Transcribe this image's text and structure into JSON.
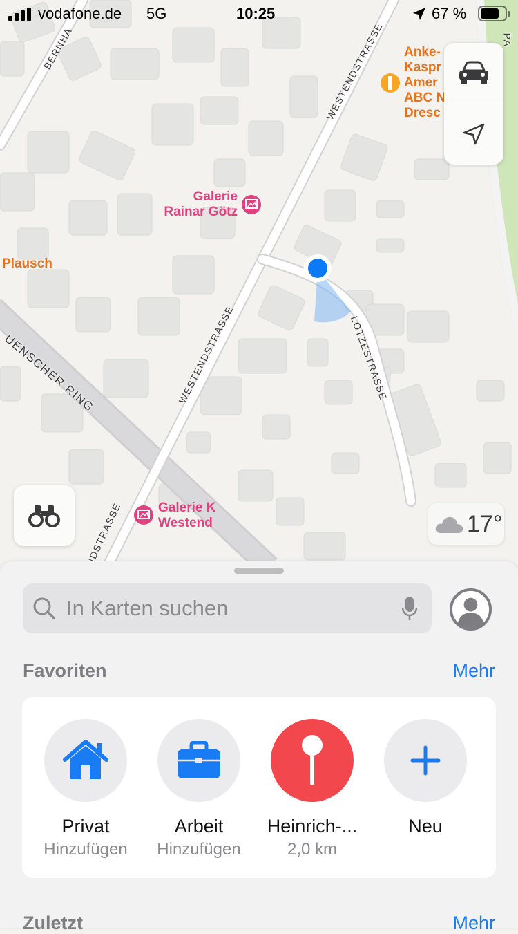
{
  "status_bar": {
    "carrier": "vodafone.de",
    "network": "5G",
    "time": "10:25",
    "battery": "67 %"
  },
  "map": {
    "pois": [
      {
        "name": "Galerie\nRainar Götz",
        "category": "gallery",
        "color": "#e0417f"
      },
      {
        "name": "Galerie K\nWestend",
        "category": "gallery",
        "color": "#e0417f"
      },
      {
        "name": "Plausch",
        "category": "restaurant",
        "color": "#e6731d"
      },
      {
        "name": "Anke-\nKaspr\nAmer\nABC N\nDresc",
        "category": "school",
        "color": "#e6731d"
      }
    ],
    "streets": [
      "WESTENDSTRASSE",
      "WESTENDSTRASSE",
      "LOTZESTRASSE",
      "UENSCHER RING",
      "BERNHA",
      "NDSTRASSE",
      "PA"
    ],
    "weather": {
      "temperature": "17°",
      "icon": "cloud-icon"
    }
  },
  "controls": {
    "drive_icon": "car-icon",
    "location_icon": "location-arrow-icon",
    "lookaround_icon": "binoculars-icon"
  },
  "sheet": {
    "search_placeholder": "In Karten suchen",
    "favorites_title": "Favoriten",
    "favorites_more": "Mehr",
    "favorites": [
      {
        "title": "Privat",
        "subtitle": "Hinzufügen",
        "icon": "home-icon",
        "color": "#1a7cf5"
      },
      {
        "title": "Arbeit",
        "subtitle": "Hinzufügen",
        "icon": "briefcase-icon",
        "color": "#1a7cf5"
      },
      {
        "title": "Heinrich-...",
        "subtitle": "2,0 km",
        "icon": "pin-icon",
        "color": "#f2474d"
      },
      {
        "title": "Neu",
        "subtitle": "",
        "icon": "plus-icon",
        "color": "#1a7cf5"
      }
    ],
    "recent_title": "Zuletzt",
    "recent_more": "Mehr"
  },
  "colors": {
    "accent": "#1a7cf5",
    "user_location": "#0a7af7"
  }
}
